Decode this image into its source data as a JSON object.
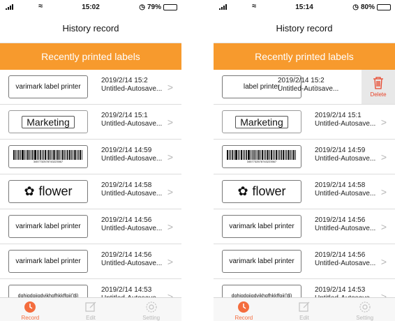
{
  "left": {
    "status": {
      "time": "15:02",
      "battery_pct": "79%",
      "battery_level": 0.79
    },
    "nav_title": "History record",
    "section_title": "Recently printed labels",
    "rows": [
      {
        "thumb_kind": "text",
        "thumb_text": "varimark label printer",
        "date": "2019/2/14 15:2",
        "name": "Untitled-Autosave..."
      },
      {
        "thumb_kind": "marketing",
        "thumb_text": "Marketing",
        "date": "2019/2/14 15:1",
        "name": "Untitled-Autosave..."
      },
      {
        "thumb_kind": "barcode",
        "thumb_text": "3457732578743223567",
        "date": "2019/2/14 14:59",
        "name": "Untitled-Autosave..."
      },
      {
        "thumb_kind": "flower",
        "thumb_text": "flower",
        "date": "2019/2/14 14:58",
        "name": "Untitled-Autosave..."
      },
      {
        "thumb_kind": "text",
        "thumb_text": "varimark label printer",
        "date": "2019/2/14 14:56",
        "name": "Untitled-Autosave..."
      },
      {
        "thumb_kind": "text",
        "thumb_text": "varimark label printer",
        "date": "2019/2/14 14:56",
        "name": "Untitled-Autosave..."
      },
      {
        "thumb_kind": "small",
        "thumb_text": "dghigdgjjgdvjkhgfhkkffgjj()$)",
        "date": "2019/2/14 14:53",
        "name": "Untitled-Autosave..."
      }
    ],
    "tabs": [
      {
        "label": "Record",
        "icon": "record-icon",
        "active": true
      },
      {
        "label": "Edit",
        "icon": "edit-icon",
        "active": false
      },
      {
        "label": "Setting",
        "icon": "gear-icon",
        "active": false
      }
    ]
  },
  "right": {
    "status": {
      "time": "15:14",
      "battery_pct": "80%",
      "battery_level": 0.8
    },
    "nav_title": "History record",
    "section_title": "Recently printed labels",
    "swiped_row": {
      "thumb_text": "label printer",
      "date": "2019/2/14 15:2",
      "name": "Untitled-Autosave...",
      "delete_label": "Delete"
    },
    "rows": [
      {
        "thumb_kind": "marketing",
        "thumb_text": "Marketing",
        "date": "2019/2/14 15:1",
        "name": "Untitled-Autosave..."
      },
      {
        "thumb_kind": "barcode",
        "thumb_text": "3457732578743223567",
        "date": "2019/2/14 14:59",
        "name": "Untitled-Autosave..."
      },
      {
        "thumb_kind": "flower",
        "thumb_text": "flower",
        "date": "2019/2/14 14:58",
        "name": "Untitled-Autosave..."
      },
      {
        "thumb_kind": "text",
        "thumb_text": "varimark label printer",
        "date": "2019/2/14 14:56",
        "name": "Untitled-Autosave..."
      },
      {
        "thumb_kind": "text",
        "thumb_text": "varimark label printer",
        "date": "2019/2/14 14:56",
        "name": "Untitled-Autosave..."
      },
      {
        "thumb_kind": "small",
        "thumb_text": "dghigdgjjgdvjkhgfhkkffgjj()$)",
        "date": "2019/2/14 14:53",
        "name": "Untitled-Autosave..."
      }
    ],
    "tabs": [
      {
        "label": "Record",
        "icon": "record-icon",
        "active": true
      },
      {
        "label": "Edit",
        "icon": "edit-icon",
        "active": false
      },
      {
        "label": "Setting",
        "icon": "gear-icon",
        "active": false
      }
    ]
  },
  "colors": {
    "accent": "#f79a2d",
    "active_tab": "#f46d3e",
    "delete": "#e8442a"
  },
  "chevron": ">"
}
